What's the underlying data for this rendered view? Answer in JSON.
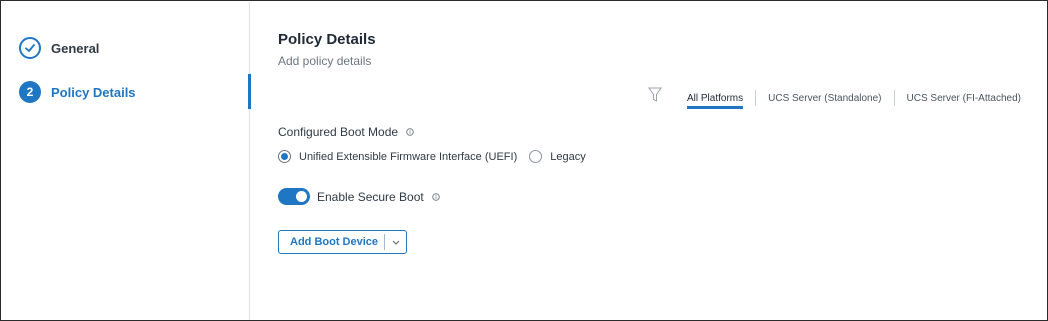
{
  "stepper": {
    "steps": [
      {
        "label": "General",
        "status": "completed",
        "icon": "check-icon"
      },
      {
        "label": "Policy Details",
        "status": "active",
        "number": "2"
      }
    ]
  },
  "main": {
    "title": "Policy Details",
    "subtitle": "Add policy details",
    "filter_icon": "filter-icon",
    "platform_tabs": [
      {
        "label": "All Platforms",
        "active": true
      },
      {
        "label": "UCS Server (Standalone)",
        "active": false
      },
      {
        "label": "UCS Server (FI-Attached)",
        "active": false
      }
    ],
    "boot_mode": {
      "label": "Configured Boot Mode",
      "options": [
        {
          "label": "Unified Extensible Firmware Interface (UEFI)",
          "checked": true
        },
        {
          "label": "Legacy",
          "checked": false
        }
      ]
    },
    "secure_boot": {
      "label": "Enable Secure Boot",
      "enabled": true
    },
    "add_boot_device": {
      "label": "Add Boot Device"
    }
  },
  "colors": {
    "accent": "#1f76c2",
    "text": "#1f2a36",
    "muted": "#6b7580"
  }
}
